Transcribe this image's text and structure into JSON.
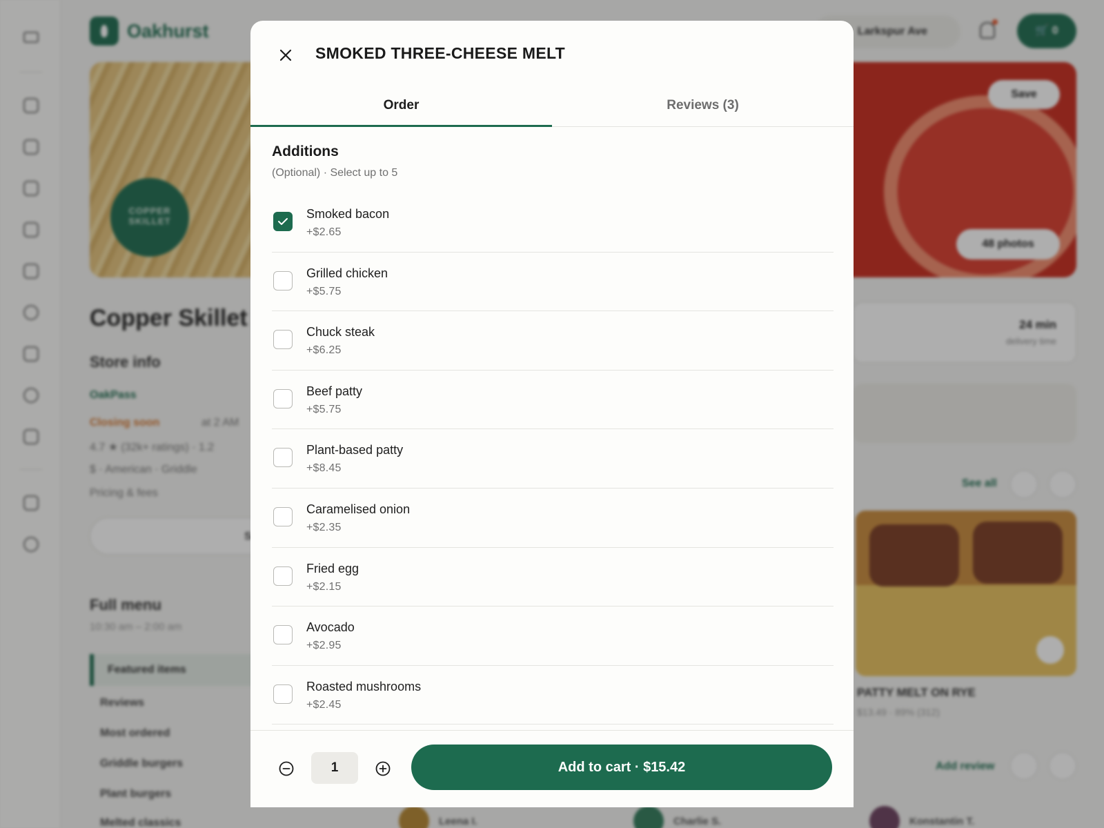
{
  "background": {
    "brand": "Oakhurst",
    "address": "Larkspur Ave",
    "cart_count": "0",
    "hero_logo_text": "COPPER SKILLET",
    "save_label": "Save",
    "photos_label": "48 photos",
    "store_name": "Copper Skillet",
    "store_info_heading": "Store info",
    "pass_label": "OakPass",
    "closing_label": "Closing soon",
    "closing_time": "at 2 AM",
    "rating_line": "4.7 ★ (32k+ ratings) · 1.2",
    "category_line": "$ · American · Griddle",
    "pricing_label": "Pricing & fees",
    "see_more_label": "See more",
    "full_menu_heading": "Full menu",
    "menu_hours": "10:30 am – 2:00 am",
    "menu_nav": [
      "Featured items",
      "Reviews",
      "Most ordered",
      "Griddle burgers",
      "Plant burgers",
      "Melted classics"
    ],
    "delivery_value": "24 min",
    "delivery_label": "delivery time",
    "see_all_label": "See all",
    "featured_title": "PATTY MELT ON RYE",
    "featured_sub": "$13.49 · 89% (312)",
    "add_review_label": "Add review",
    "reviewers": [
      "Leena I.",
      "Charlie S.",
      "Konstantin T."
    ]
  },
  "modal": {
    "title": "SMOKED THREE-CHEESE MELT",
    "tabs": [
      {
        "label": "Order",
        "active": true
      },
      {
        "label": "Reviews (3)",
        "active": false
      }
    ],
    "section": {
      "title": "Additions",
      "subtitle": "(Optional) · Select up to 5"
    },
    "options": [
      {
        "name": "Smoked bacon",
        "price": "+$2.65",
        "checked": true
      },
      {
        "name": "Grilled chicken",
        "price": "+$5.75",
        "checked": false
      },
      {
        "name": "Chuck steak",
        "price": "+$6.25",
        "checked": false
      },
      {
        "name": "Beef patty",
        "price": "+$5.75",
        "checked": false
      },
      {
        "name": "Plant-based patty",
        "price": "+$8.45",
        "checked": false
      },
      {
        "name": "Caramelised onion",
        "price": "+$2.35",
        "checked": false
      },
      {
        "name": "Fried egg",
        "price": "+$2.15",
        "checked": false
      },
      {
        "name": "Avocado",
        "price": "+$2.95",
        "checked": false
      },
      {
        "name": "Roasted mushrooms",
        "price": "+$2.45",
        "checked": false
      }
    ],
    "quantity": "1",
    "add_to_cart_label": "Add to cart · $15.42"
  },
  "colors": {
    "accent": "#1d6b4f",
    "scrim": "rgba(30,30,30,0.36)",
    "divider": "#e4e4e0"
  },
  "icons": {
    "close": "close-icon",
    "minus": "minus-circle-icon",
    "plus": "plus-circle-icon",
    "check": "checkmark-icon"
  }
}
